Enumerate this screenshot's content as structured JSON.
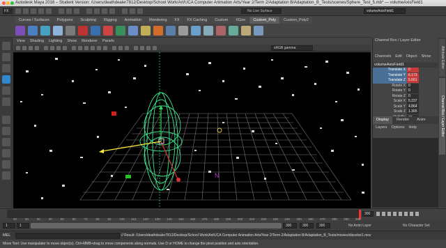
{
  "window": {
    "title": "Autodesk Maya 2016 – Student Version: /Users/deathdealer7812/Desktop/School Work/Art/UCA Computer Animation Arts/Year 2/Term 2/Adaptation B/Adaptation_B_Tests/scenes/Sphere_Test_5.mb* — volumeAxisField1",
    "title_right": "volumeAxisField1"
  },
  "statusline": {
    "mode": "FX",
    "live_surface": "No Live Surface",
    "object_field": "volumeAxisField1"
  },
  "shelf": {
    "tabs": [
      "Curves / Surfaces",
      "Polygons",
      "Sculpting",
      "Rigging",
      "Animation",
      "Rendering",
      "FX",
      "FX Caching",
      "Custom",
      "XGen",
      "Custom_Poly",
      "Custom_Poly2"
    ],
    "active_tab": "Custom_Poly"
  },
  "panel": {
    "menu": [
      "View",
      "Shading",
      "Lighting",
      "Show",
      "Renderer",
      "Panels"
    ],
    "color_space": "sRGB gamma"
  },
  "viewport": {
    "manip_label": "N"
  },
  "channel_box": {
    "header": "Channel Box / Layer Editor",
    "menu": [
      "Channels",
      "Edit",
      "Object",
      "Show"
    ],
    "node": "volumeAxisField1",
    "channels": [
      {
        "label": "Translate X",
        "value": "0",
        "selected": true
      },
      {
        "label": "Translate Y",
        "value": "6.173",
        "selected": true
      },
      {
        "label": "Translate Z",
        "value": "5.661",
        "selected": true
      },
      {
        "label": "Rotate X",
        "value": "0",
        "selected": false
      },
      {
        "label": "Rotate Y",
        "value": "0",
        "selected": false
      },
      {
        "label": "Rotate Z",
        "value": "0",
        "selected": false
      },
      {
        "label": "Scale X",
        "value": "5.237",
        "selected": false
      },
      {
        "label": "Scale Y",
        "value": "4.864",
        "selected": false
      },
      {
        "label": "Scale Z",
        "value": "1.365",
        "selected": false
      },
      {
        "label": "Visibility",
        "value": "on",
        "selected": false
      }
    ],
    "layer_tabs": [
      "Display",
      "Render",
      "Anim"
    ],
    "layer_menu": [
      "Layers",
      "Options",
      "Help"
    ]
  },
  "side_tabs": [
    "Attribute Editor",
    "Channel Box / Layer Editor"
  ],
  "time_slider": {
    "current_frame": "300",
    "ticks": [
      "10",
      "20",
      "30",
      "40",
      "50",
      "60",
      "70",
      "80",
      "90",
      "100",
      "110",
      "120",
      "130",
      "140",
      "150",
      "160",
      "170",
      "180",
      "190",
      "200",
      "210",
      "220",
      "230",
      "240",
      "250",
      "260",
      "270",
      "280",
      "290",
      "300"
    ]
  },
  "range_slider": {
    "start": "1",
    "playback_start": "1",
    "playback_end": "300",
    "end": "300",
    "range_end": "300",
    "anim_layer": "No Anim Layer",
    "character_set": "No Character Set"
  },
  "command_line": {
    "label": "MEL",
    "result": "// Result: /Users/deathdealer7812/Desktop/School Work/Art/UCA Computer Animation Arts/Year 2/Term 2/Adaptation B/Adaptation_B_Tests/movies/dissolve1.mov"
  },
  "help_line": "Move Tool: Use manipulator to move object(s). Ctrl+MMB+drag to move components along normals. Use D or HOME to change the pivot position and axis orientation."
}
